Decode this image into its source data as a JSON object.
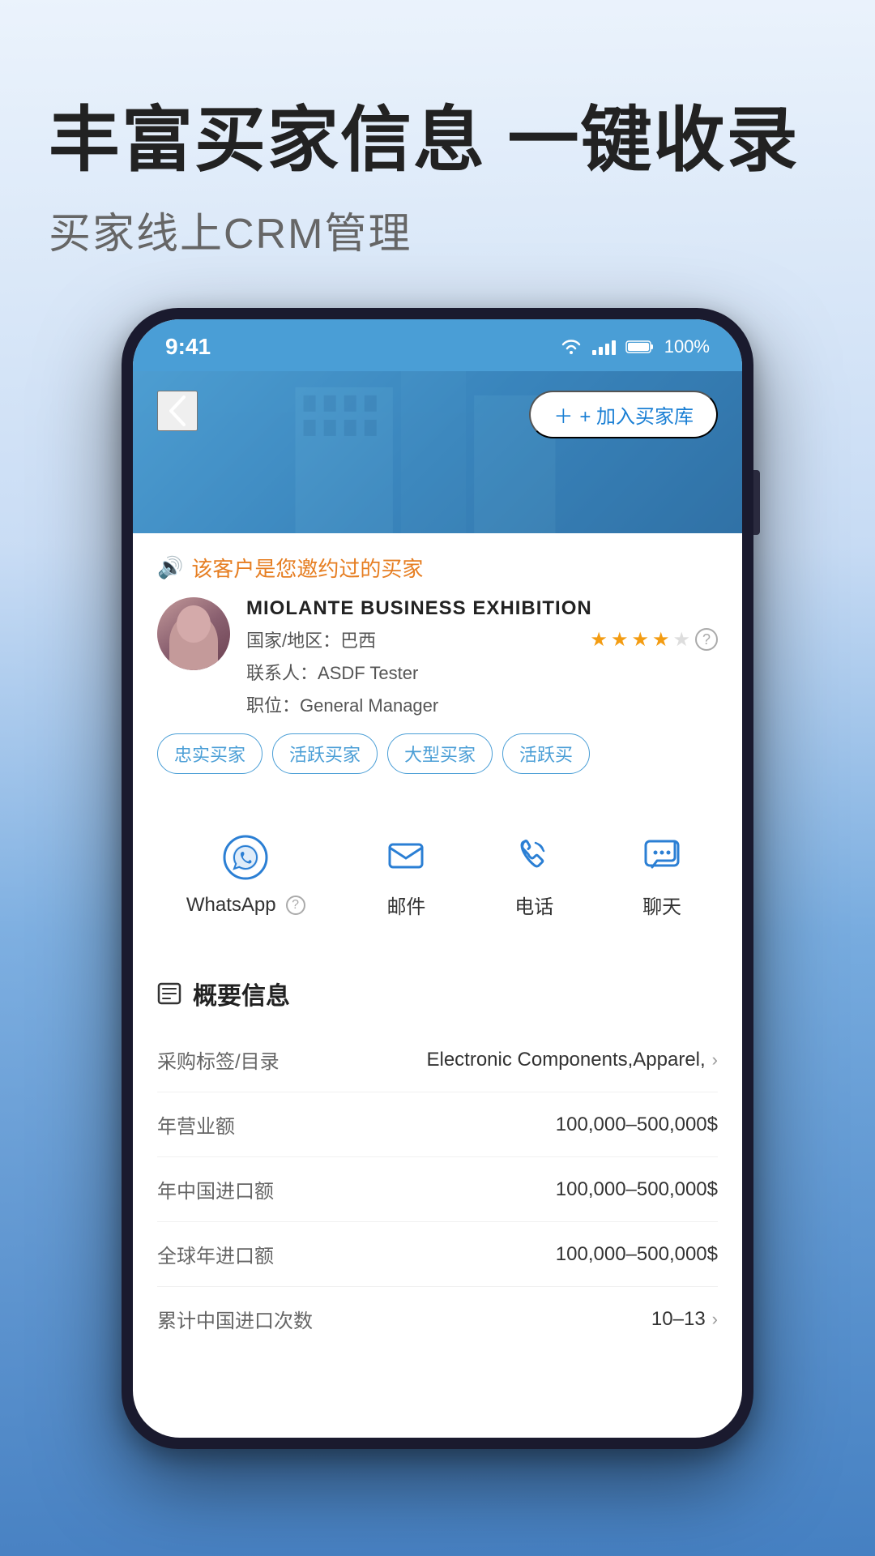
{
  "background": {
    "gradient_start": "#e8f0f8",
    "gradient_end": "#7aaed8"
  },
  "header": {
    "main_title": "丰富买家信息 一键收录",
    "sub_title": "买家线上CRM管理"
  },
  "phone": {
    "status_bar": {
      "time": "9:41",
      "battery": "100%"
    },
    "top_bar": {
      "back_label": "‹",
      "add_button": "+ 加入买家库"
    },
    "notice": {
      "text": "该客户是您邀约过的买家"
    },
    "customer": {
      "company": "MIOLANTE BUSINESS EXHIBITION",
      "country_label": "国家/地区：",
      "country": "巴西",
      "contact_label": "联系人：",
      "contact": "ASDF Tester",
      "position_label": "职位：",
      "position": "General Manager",
      "stars_filled": 4,
      "stars_total": 5
    },
    "tags": [
      "忠实买家",
      "活跃买家",
      "大型买家",
      "活跃买"
    ],
    "actions": [
      {
        "id": "whatsapp",
        "label": "WhatsApp",
        "has_help": true
      },
      {
        "id": "email",
        "label": "邮件",
        "has_help": false
      },
      {
        "id": "phone",
        "label": "电话",
        "has_help": false
      },
      {
        "id": "chat",
        "label": "聊天",
        "has_help": false
      }
    ],
    "info_section": {
      "title": "概要信息",
      "rows": [
        {
          "label": "采购标签/目录",
          "value": "Electronic Components,Apparel,",
          "has_chevron": true
        },
        {
          "label": "年营业额",
          "value": "100,000–500,000$",
          "has_chevron": false
        },
        {
          "label": "年中国进口额",
          "value": "100,000–500,000$",
          "has_chevron": false
        },
        {
          "label": "全球年进口额",
          "value": "100,000–500,000$",
          "has_chevron": false
        },
        {
          "label": "累计中国进口次数",
          "value": "10–13",
          "has_chevron": true
        }
      ]
    }
  }
}
